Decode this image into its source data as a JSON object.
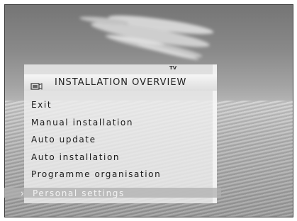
{
  "menu": {
    "tv_label": "TV",
    "icon": "tv-menu-icon",
    "title": "INSTALLATION OVERVIEW",
    "items": [
      {
        "label": "Exit"
      },
      {
        "label": "Manual installation"
      },
      {
        "label": "Auto update"
      },
      {
        "label": "Auto installation"
      },
      {
        "label": "Programme organisation"
      },
      {
        "label": "Personal settings"
      }
    ],
    "selected_arrow": "›"
  }
}
